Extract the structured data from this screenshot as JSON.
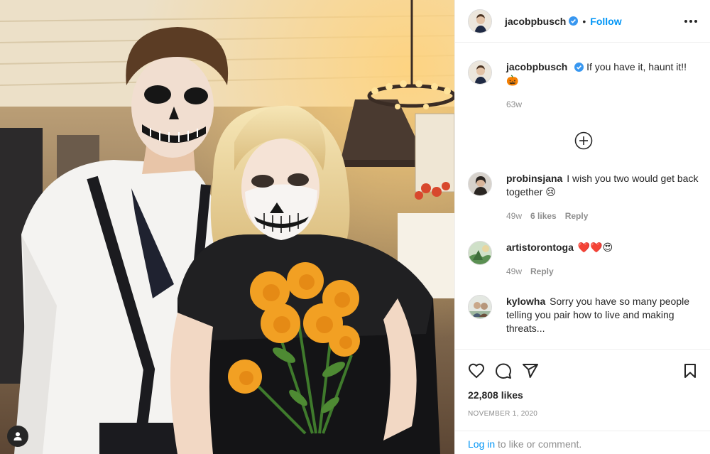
{
  "post": {
    "author": "jacobpbusch",
    "follow_label": "Follow",
    "caption_text": "If you have it, haunt it!!",
    "caption_emoji": "🎃",
    "caption_time": "63w",
    "likes": "22,808 likes",
    "date": "November 1, 2020"
  },
  "comments": [
    {
      "username": "probinsjana",
      "text": "I wish you two would get back together 😢",
      "time": "49w",
      "likes": "6 likes",
      "reply_label": "Reply"
    },
    {
      "username": "artistorontoga",
      "text": "❤️❤️😍",
      "time": "49w",
      "reply_label": "Reply"
    },
    {
      "username": "kylowha",
      "text": "Sorry you have so many people telling you pair how to live and making threats..."
    }
  ],
  "login": {
    "link_text": "Log in",
    "suffix_text": "to like or comment."
  },
  "colors": {
    "accent": "#0095f6",
    "text": "#262626",
    "muted": "#8e8e8e",
    "border": "#efefef"
  },
  "icons": [
    "verified-badge-icon",
    "more-options-icon",
    "load-more-comments-icon",
    "heart-icon",
    "comment-icon",
    "share-icon",
    "bookmark-icon",
    "user-tag-icon"
  ]
}
